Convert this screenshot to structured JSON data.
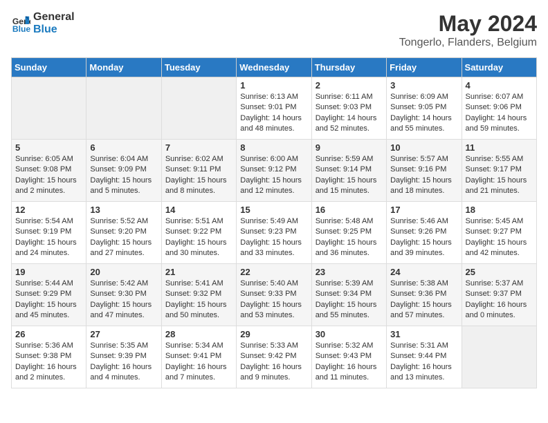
{
  "header": {
    "logo_line1": "General",
    "logo_line2": "Blue",
    "title": "May 2024",
    "subtitle": "Tongerlo, Flanders, Belgium"
  },
  "weekdays": [
    "Sunday",
    "Monday",
    "Tuesday",
    "Wednesday",
    "Thursday",
    "Friday",
    "Saturday"
  ],
  "weeks": [
    [
      {
        "day": "",
        "info": ""
      },
      {
        "day": "",
        "info": ""
      },
      {
        "day": "",
        "info": ""
      },
      {
        "day": "1",
        "info": "Sunrise: 6:13 AM\nSunset: 9:01 PM\nDaylight: 14 hours\nand 48 minutes."
      },
      {
        "day": "2",
        "info": "Sunrise: 6:11 AM\nSunset: 9:03 PM\nDaylight: 14 hours\nand 52 minutes."
      },
      {
        "day": "3",
        "info": "Sunrise: 6:09 AM\nSunset: 9:05 PM\nDaylight: 14 hours\nand 55 minutes."
      },
      {
        "day": "4",
        "info": "Sunrise: 6:07 AM\nSunset: 9:06 PM\nDaylight: 14 hours\nand 59 minutes."
      }
    ],
    [
      {
        "day": "5",
        "info": "Sunrise: 6:05 AM\nSunset: 9:08 PM\nDaylight: 15 hours\nand 2 minutes."
      },
      {
        "day": "6",
        "info": "Sunrise: 6:04 AM\nSunset: 9:09 PM\nDaylight: 15 hours\nand 5 minutes."
      },
      {
        "day": "7",
        "info": "Sunrise: 6:02 AM\nSunset: 9:11 PM\nDaylight: 15 hours\nand 8 minutes."
      },
      {
        "day": "8",
        "info": "Sunrise: 6:00 AM\nSunset: 9:12 PM\nDaylight: 15 hours\nand 12 minutes."
      },
      {
        "day": "9",
        "info": "Sunrise: 5:59 AM\nSunset: 9:14 PM\nDaylight: 15 hours\nand 15 minutes."
      },
      {
        "day": "10",
        "info": "Sunrise: 5:57 AM\nSunset: 9:16 PM\nDaylight: 15 hours\nand 18 minutes."
      },
      {
        "day": "11",
        "info": "Sunrise: 5:55 AM\nSunset: 9:17 PM\nDaylight: 15 hours\nand 21 minutes."
      }
    ],
    [
      {
        "day": "12",
        "info": "Sunrise: 5:54 AM\nSunset: 9:19 PM\nDaylight: 15 hours\nand 24 minutes."
      },
      {
        "day": "13",
        "info": "Sunrise: 5:52 AM\nSunset: 9:20 PM\nDaylight: 15 hours\nand 27 minutes."
      },
      {
        "day": "14",
        "info": "Sunrise: 5:51 AM\nSunset: 9:22 PM\nDaylight: 15 hours\nand 30 minutes."
      },
      {
        "day": "15",
        "info": "Sunrise: 5:49 AM\nSunset: 9:23 PM\nDaylight: 15 hours\nand 33 minutes."
      },
      {
        "day": "16",
        "info": "Sunrise: 5:48 AM\nSunset: 9:25 PM\nDaylight: 15 hours\nand 36 minutes."
      },
      {
        "day": "17",
        "info": "Sunrise: 5:46 AM\nSunset: 9:26 PM\nDaylight: 15 hours\nand 39 minutes."
      },
      {
        "day": "18",
        "info": "Sunrise: 5:45 AM\nSunset: 9:27 PM\nDaylight: 15 hours\nand 42 minutes."
      }
    ],
    [
      {
        "day": "19",
        "info": "Sunrise: 5:44 AM\nSunset: 9:29 PM\nDaylight: 15 hours\nand 45 minutes."
      },
      {
        "day": "20",
        "info": "Sunrise: 5:42 AM\nSunset: 9:30 PM\nDaylight: 15 hours\nand 47 minutes."
      },
      {
        "day": "21",
        "info": "Sunrise: 5:41 AM\nSunset: 9:32 PM\nDaylight: 15 hours\nand 50 minutes."
      },
      {
        "day": "22",
        "info": "Sunrise: 5:40 AM\nSunset: 9:33 PM\nDaylight: 15 hours\nand 53 minutes."
      },
      {
        "day": "23",
        "info": "Sunrise: 5:39 AM\nSunset: 9:34 PM\nDaylight: 15 hours\nand 55 minutes."
      },
      {
        "day": "24",
        "info": "Sunrise: 5:38 AM\nSunset: 9:36 PM\nDaylight: 15 hours\nand 57 minutes."
      },
      {
        "day": "25",
        "info": "Sunrise: 5:37 AM\nSunset: 9:37 PM\nDaylight: 16 hours\nand 0 minutes."
      }
    ],
    [
      {
        "day": "26",
        "info": "Sunrise: 5:36 AM\nSunset: 9:38 PM\nDaylight: 16 hours\nand 2 minutes."
      },
      {
        "day": "27",
        "info": "Sunrise: 5:35 AM\nSunset: 9:39 PM\nDaylight: 16 hours\nand 4 minutes."
      },
      {
        "day": "28",
        "info": "Sunrise: 5:34 AM\nSunset: 9:41 PM\nDaylight: 16 hours\nand 7 minutes."
      },
      {
        "day": "29",
        "info": "Sunrise: 5:33 AM\nSunset: 9:42 PM\nDaylight: 16 hours\nand 9 minutes."
      },
      {
        "day": "30",
        "info": "Sunrise: 5:32 AM\nSunset: 9:43 PM\nDaylight: 16 hours\nand 11 minutes."
      },
      {
        "day": "31",
        "info": "Sunrise: 5:31 AM\nSunset: 9:44 PM\nDaylight: 16 hours\nand 13 minutes."
      },
      {
        "day": "",
        "info": ""
      }
    ]
  ]
}
